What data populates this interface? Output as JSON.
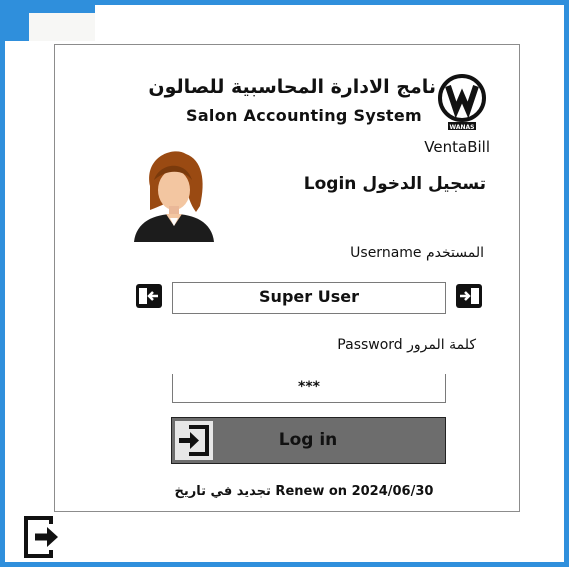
{
  "app": {
    "title_ar": "نامج الادارة المحاسبية للصالون",
    "title_en": "Salon Accounting System",
    "brand": "VentaBill",
    "logo_text": "WANAS"
  },
  "login": {
    "heading": "تسجيل الدخول Login",
    "username_label": "المستخدم  Username",
    "username_value": "Super User",
    "password_label": "كلمة المرور  Password",
    "password_value": "***",
    "button_label": "Log in",
    "renew_text": "تجديد في تاريخ Renew on 2024/06/30"
  },
  "icons": {
    "logo": "wanas-logo-icon",
    "avatar": "user-avatar-icon",
    "username_left": "keyboard-switch-left-icon",
    "username_right": "keyboard-switch-right-icon",
    "login_button": "login-arrow-icon",
    "exit": "exit-icon"
  },
  "colors": {
    "frame": "#2f8fdc",
    "button": "#6d6d6d"
  }
}
